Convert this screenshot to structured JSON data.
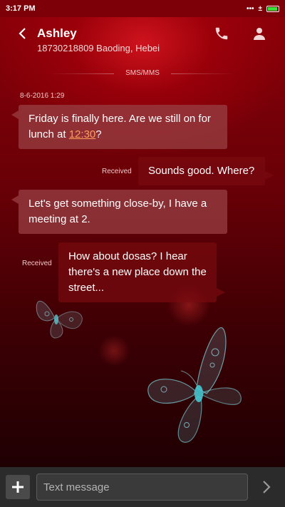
{
  "status_bar": {
    "time": "3:17 PM",
    "icons": [
      "dots-icon",
      "usb-debug-icon",
      "battery-icon"
    ],
    "battery_color": "#3adf3a"
  },
  "header": {
    "contact_name": "Ashley",
    "contact_detail": "18730218809 Baoding, Hebei",
    "icons": [
      "back-arrow-icon",
      "phone-icon",
      "person-icon"
    ]
  },
  "conversation": {
    "channel": "SMS/MMS",
    "timestamp": "8-6-2016 1:29",
    "messages": [
      {
        "side": "left",
        "text_before": "Friday is finally here. Are we still on for lunch at ",
        "link": "12:30",
        "text_after": "?"
      },
      {
        "side": "right",
        "status": "Received",
        "text": "Sounds good. Where?"
      },
      {
        "side": "left",
        "text": "Let's get something close-by, I have a meeting at 2."
      },
      {
        "side": "right",
        "status": "Received",
        "text": "How about dosas? I hear there's a new place down the street..."
      }
    ]
  },
  "composer": {
    "placeholder": "Text message",
    "icons": [
      "plus-icon",
      "send-chevron-icon"
    ]
  },
  "theme": {
    "accent_red": "#8a0009",
    "link_color": "#ff9d5c",
    "composer_bg": "#2b2b2b"
  }
}
